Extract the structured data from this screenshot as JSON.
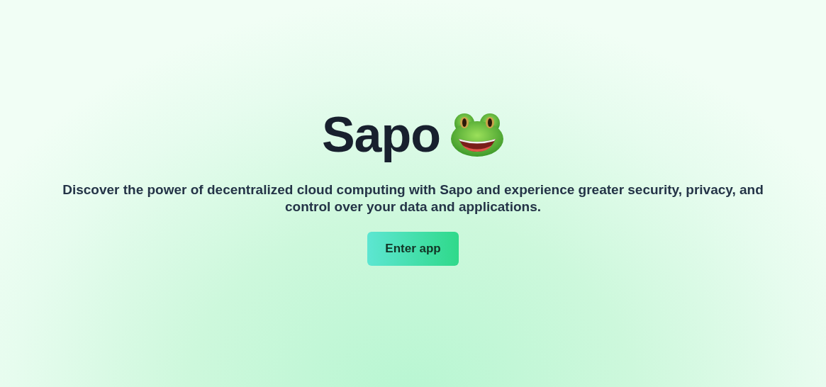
{
  "hero": {
    "title": "Sapo",
    "description": "Discover the power of decentralized cloud computing with Sapo and experience greater security, privacy, and control over your data and applications.",
    "button": "Enter app"
  }
}
